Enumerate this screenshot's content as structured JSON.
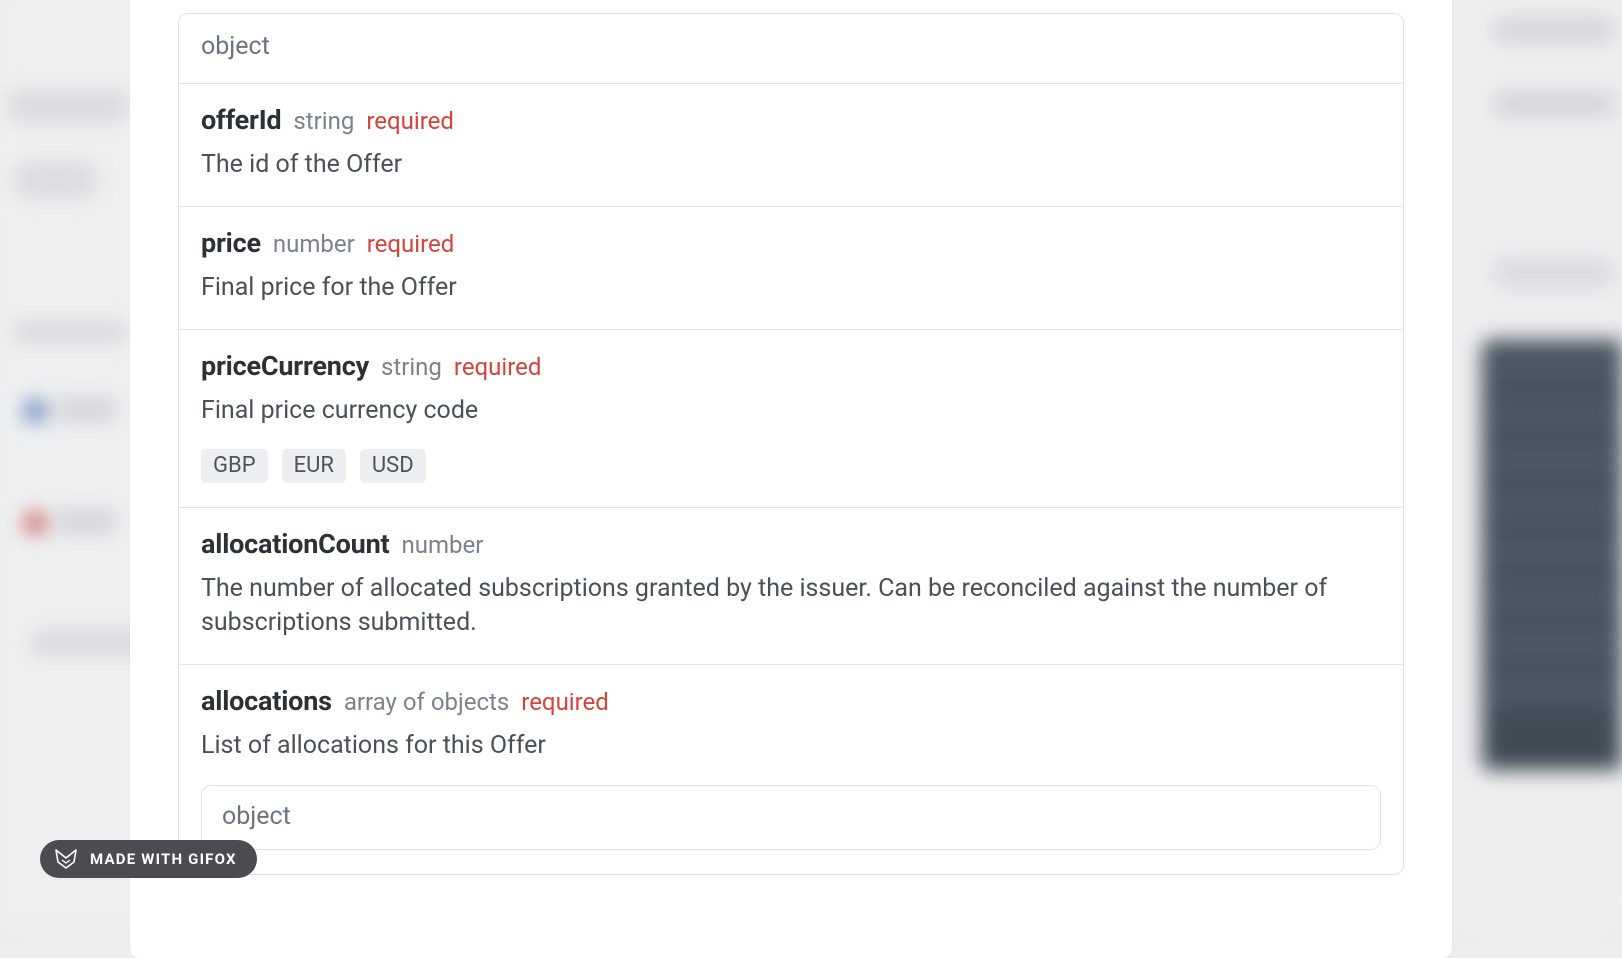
{
  "schema": {
    "header": "object",
    "props": [
      {
        "name": "offerId",
        "type": "string",
        "required": "required",
        "desc": "The id of the Offer"
      },
      {
        "name": "price",
        "type": "number",
        "required": "required",
        "desc": "Final price for the Offer"
      },
      {
        "name": "priceCurrency",
        "type": "string",
        "required": "required",
        "desc": "Final price currency code",
        "enums": [
          "GBP",
          "EUR",
          "USD"
        ]
      },
      {
        "name": "allocationCount",
        "type": "number",
        "required": "",
        "desc": "The number of allocated subscriptions granted by the issuer. Can be reconciled against the number of subscriptions submitted."
      },
      {
        "name": "allocations",
        "type": "array of objects",
        "required": "required",
        "desc": "List of allocations for this Offer",
        "nested_header": "object"
      }
    ]
  },
  "badge": {
    "text": "MADE WITH GIFOX"
  }
}
